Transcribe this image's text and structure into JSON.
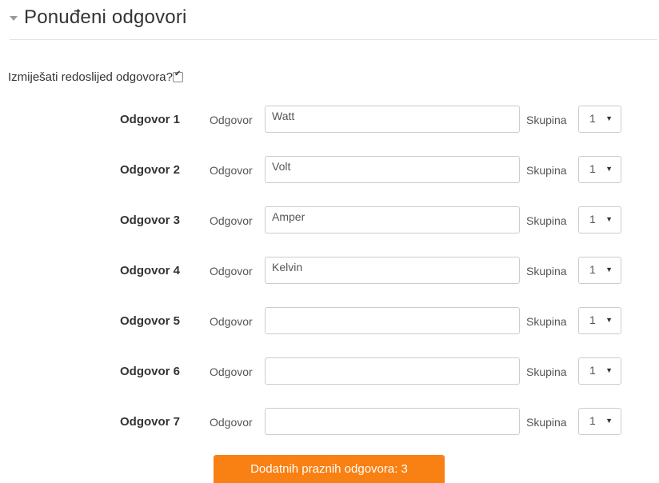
{
  "section": {
    "title": "Ponuđeni odgovori"
  },
  "shuffle": {
    "label": "Izmiješati redoslijed odgovora?",
    "checked": true
  },
  "answers": [
    {
      "label": "Odgovor 1",
      "field_label": "Odgovor",
      "value": "Watt",
      "group_label": "Skupina",
      "group": "1"
    },
    {
      "label": "Odgovor 2",
      "field_label": "Odgovor",
      "value": "Volt",
      "group_label": "Skupina",
      "group": "1"
    },
    {
      "label": "Odgovor 3",
      "field_label": "Odgovor",
      "value": "Amper",
      "group_label": "Skupina",
      "group": "1"
    },
    {
      "label": "Odgovor 4",
      "field_label": "Odgovor",
      "value": "Kelvin",
      "group_label": "Skupina",
      "group": "1"
    },
    {
      "label": "Odgovor 5",
      "field_label": "Odgovor",
      "value": "",
      "group_label": "Skupina",
      "group": "1"
    },
    {
      "label": "Odgovor 6",
      "field_label": "Odgovor",
      "value": "",
      "group_label": "Skupina",
      "group": "1"
    },
    {
      "label": "Odgovor 7",
      "field_label": "Odgovor",
      "value": "",
      "group_label": "Skupina",
      "group": "1"
    }
  ],
  "add_button": {
    "label": "Dodatnih praznih odgovora: 3"
  },
  "icons": {
    "collapse": "caret-down-icon",
    "select": "chevron-down-icon"
  },
  "colors": {
    "accent": "#f98012"
  }
}
